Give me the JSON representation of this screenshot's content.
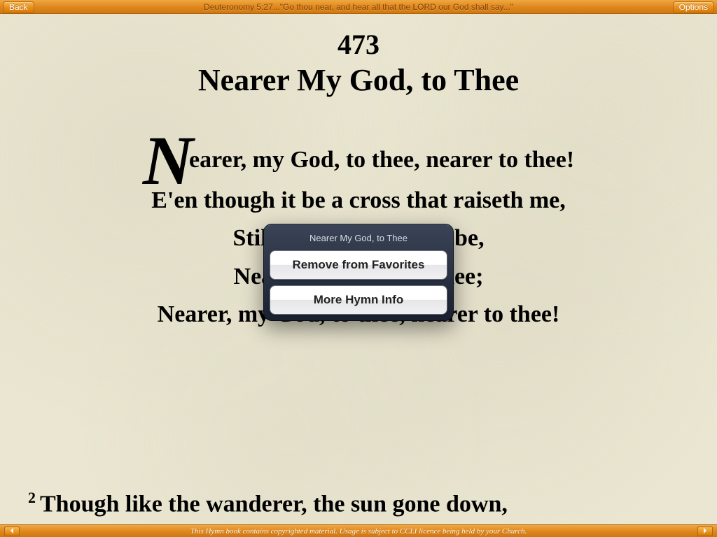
{
  "topbar": {
    "back_label": "Back",
    "options_label": "Options",
    "scripture": "Deuteronomy 5:27...\"Go thou near, and hear all that the LORD our God shall say...\""
  },
  "hymn": {
    "number": "473",
    "title": "Nearer My God, to Thee",
    "verse1": {
      "dropcap": "N",
      "line1_rest": "earer, my God, to thee, nearer to thee!",
      "line2": "E'en though it be a cross that raiseth me,",
      "line3": "Still all my song shall be,",
      "line4": "Nearer, my God, to thee;",
      "line5": "Nearer, my God, to thee, nearer to thee!"
    },
    "verse2": {
      "num": "2",
      "line1": "Though like the wanderer, the sun gone down,"
    }
  },
  "popup": {
    "title": "Nearer My God, to Thee",
    "remove_label": "Remove from Favorites",
    "info_label": "More Hymn Info"
  },
  "bottombar": {
    "text": "This Hymn book contains copyrighted material. Usage is subject to CCLI licence being held by your Church."
  }
}
